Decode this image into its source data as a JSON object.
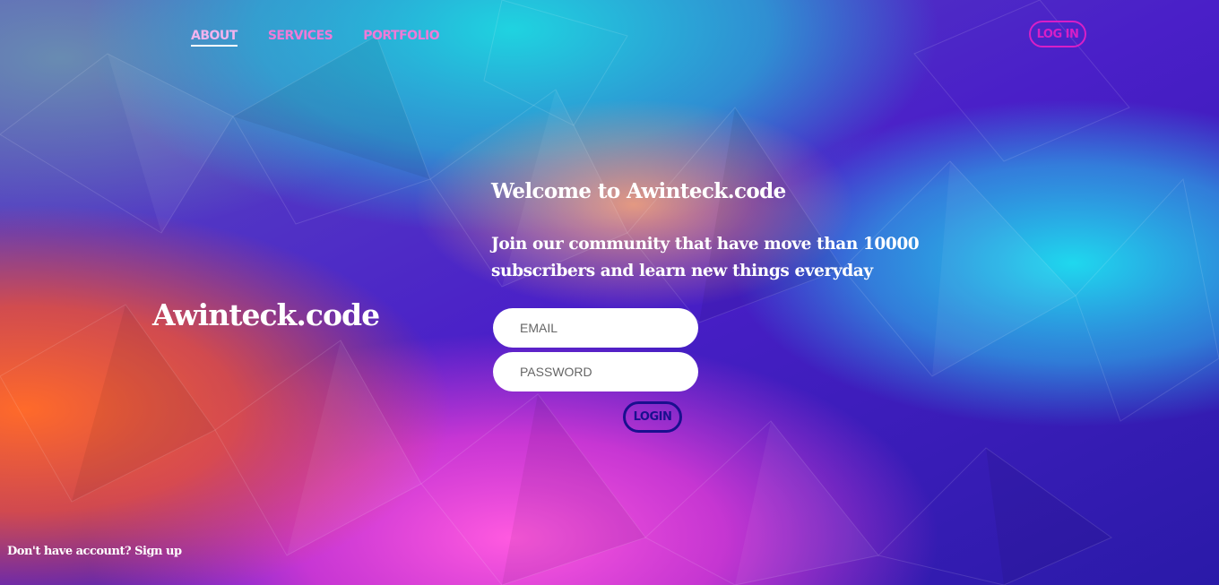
{
  "nav": {
    "items": [
      {
        "label": "ABOUT"
      },
      {
        "label": "SERVICES"
      },
      {
        "label": "PORTFOLIO"
      }
    ],
    "login_label": "LOG IN"
  },
  "brand": {
    "title": "Awinteck.code"
  },
  "hero": {
    "welcome": "Welcome to Awinteck.code",
    "subtitle": "Join our community that have move than 10000 subscribers and learn new things everyday"
  },
  "form": {
    "email_placeholder": "EMAIL",
    "password_placeholder": "PASSWORD",
    "submit_label": "LOGIN"
  },
  "footer": {
    "signup_prompt": "Don't have account?",
    "signup_link": "Sign up"
  },
  "colors": {
    "nav_active": "#f2b3ee",
    "nav_item": "#f07ad8",
    "login_top": "#d81fc7",
    "login_button": "#1a0f8f",
    "text": "#ffffff"
  }
}
